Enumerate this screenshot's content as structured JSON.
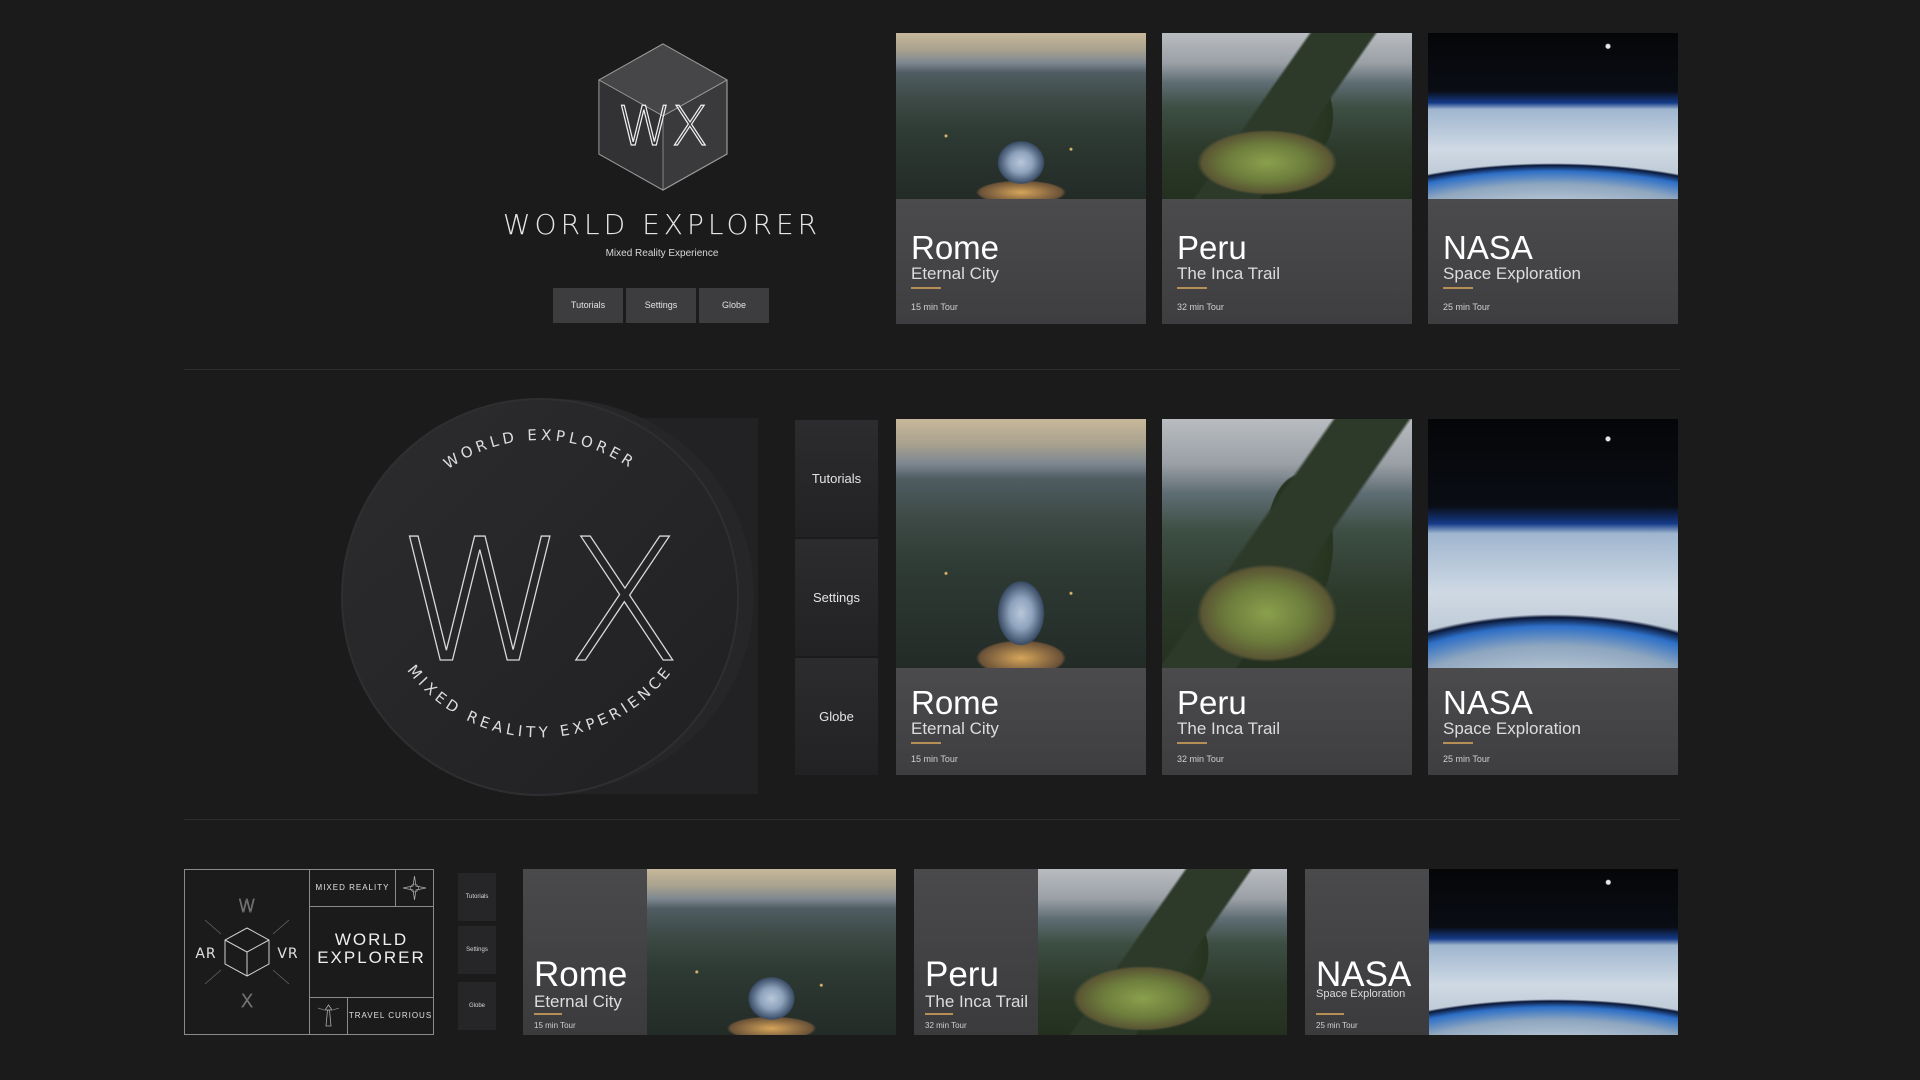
{
  "brand": {
    "name": "WORLD EXPLORER",
    "tagline": "Mixed Reality Experience",
    "monogram": "WX",
    "disc_arc_top": "WORLD EXPLORER",
    "disc_arc_bottom": "MIXED REALITY EXPERIENCE",
    "grid": {
      "top_label": "MIXED REALITY",
      "bottom_label": "TRAVEL CURIOUS",
      "center_line1": "WORLD",
      "center_line2": "EXPLORER",
      "left": "AR",
      "right": "VR",
      "top": "W",
      "bottom": "X"
    }
  },
  "menu": {
    "tutorials": "Tutorials",
    "settings": "Settings",
    "globe": "Globe"
  },
  "tours": [
    {
      "title": "Rome",
      "subtitle": "Eternal City",
      "duration": "15 min Tour"
    },
    {
      "title": "Peru",
      "subtitle": "The Inca Trail",
      "duration": "32 min Tour"
    },
    {
      "title": "NASA",
      "subtitle": "Space Exploration",
      "duration": "25 min Tour"
    }
  ],
  "colors": {
    "background": "#1b1b1c",
    "card": "#48484a",
    "accent_rule": "#b58f55",
    "text": "#ffffff"
  },
  "icons": [
    "wx-cube-logo",
    "wx-disc-logo",
    "compass-star-icon",
    "lighthouse-icon",
    "isometric-cube-icon"
  ]
}
